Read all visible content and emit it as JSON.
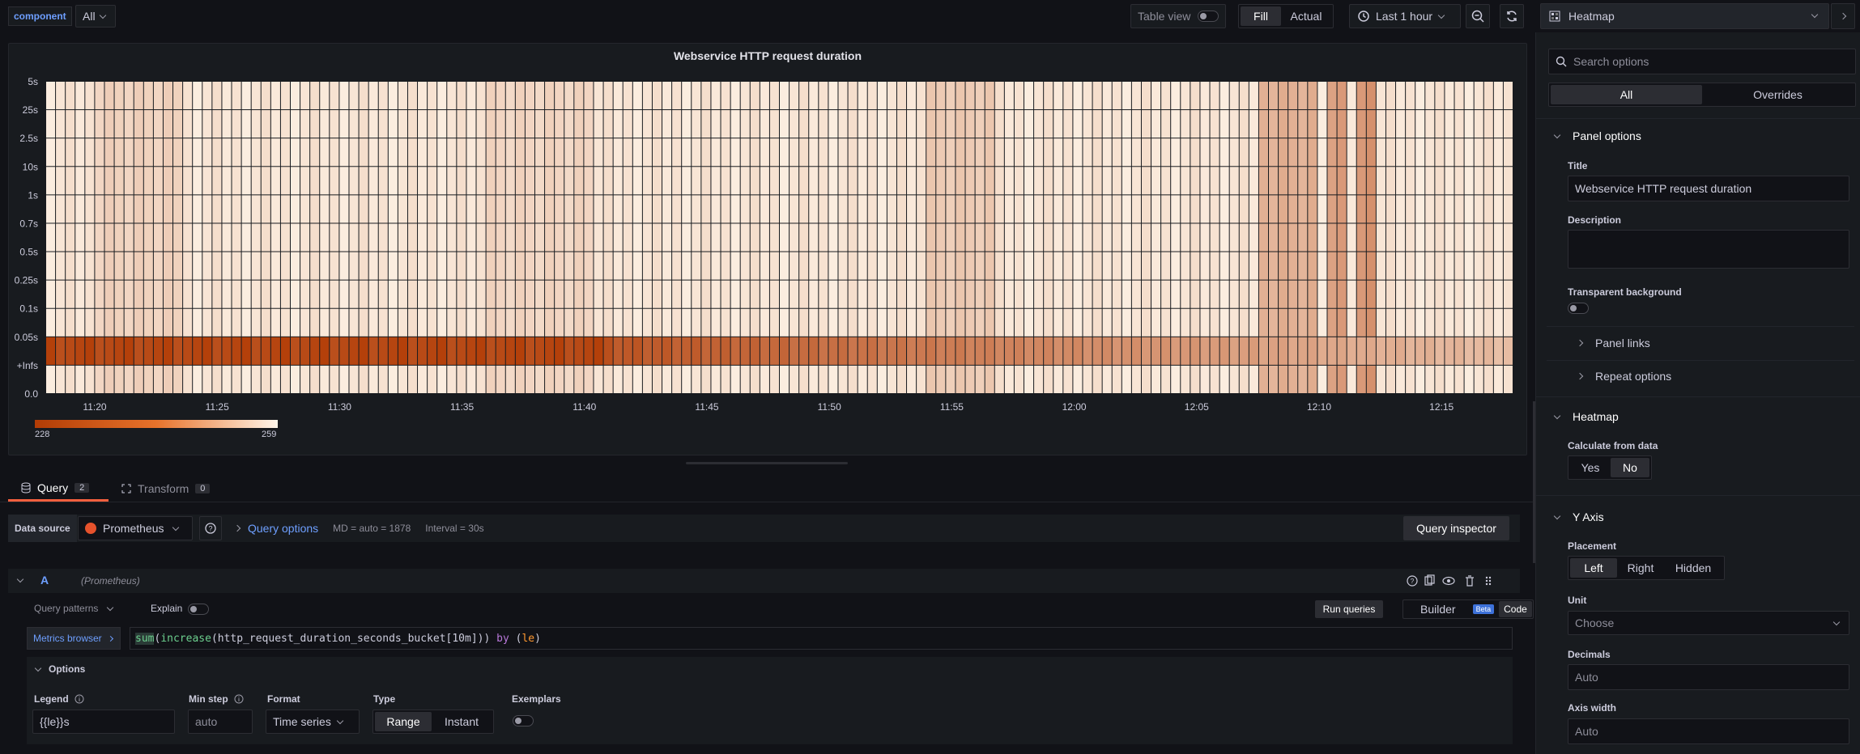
{
  "toolbar": {
    "var_label": "component",
    "var_value": "All",
    "table_view_label": "Table view",
    "fill_label": "Fill",
    "actual_label": "Actual",
    "time_range": "Last 1 hour",
    "viz_type": "Heatmap"
  },
  "panel": {
    "title": "Webservice HTTP request duration",
    "legend_min": "228",
    "legend_max": "259"
  },
  "chart_data": {
    "type": "heatmap",
    "title": "Webservice HTTP request duration",
    "y_buckets": [
      "5s",
      "25s",
      "2.5s",
      "10s",
      "1s",
      "0.7s",
      "0.5s",
      "0.25s",
      "0.1s",
      "0.05s",
      "+Infs",
      "0.0"
    ],
    "x_ticks": [
      "11:20",
      "11:25",
      "11:30",
      "11:35",
      "11:40",
      "11:45",
      "11:50",
      "11:55",
      "12:00",
      "12:05",
      "12:10",
      "12:15"
    ],
    "color_scale": {
      "min": 228,
      "max": 259,
      "low_color": "#b23c05",
      "high_color": "#fff6ea"
    },
    "legend_range": [
      228,
      259
    ]
  },
  "tabs": {
    "query_label": "Query",
    "query_count": "2",
    "transform_label": "Transform",
    "transform_count": "0"
  },
  "query_bar": {
    "datasource_label": "Data source",
    "datasource": "Prometheus",
    "query_options_label": "Query options",
    "md": "MD = auto = 1878",
    "interval": "Interval = 30s",
    "inspector_label": "Query inspector"
  },
  "query": {
    "ref_id": "A",
    "ds_name": "(Prometheus)",
    "patterns_label": "Query patterns",
    "explain_label": "Explain",
    "run_label": "Run queries",
    "builder_label": "Builder",
    "beta_label": "Beta",
    "code_label": "Code",
    "metrics_browser": "Metrics browser",
    "expr_parts": [
      "sum",
      "(",
      "increase",
      "(http_request_duration_seconds_bucket[10m])) ",
      "by",
      " (",
      "le",
      ")"
    ],
    "options_label": "Options",
    "legend_label": "Legend",
    "legend_value": "{{le}}s",
    "minstep_label": "Min step",
    "minstep_placeholder": "auto",
    "format_label": "Format",
    "format_value": "Time series",
    "type_label": "Type",
    "range_label": "Range",
    "instant_label": "Instant",
    "exemplars_label": "Exemplars"
  },
  "options_pane": {
    "search_placeholder": "Search options",
    "all_tab": "All",
    "overrides_tab": "Overrides",
    "panel_options": "Panel options",
    "title_label": "Title",
    "title_value": "Webservice HTTP request duration",
    "description_label": "Description",
    "transparent_label": "Transparent background",
    "panel_links": "Panel links",
    "repeat_options": "Repeat options",
    "heatmap_section": "Heatmap",
    "calc_label": "Calculate from data",
    "yes": "Yes",
    "no": "No",
    "yaxis_section": "Y Axis",
    "placement_label": "Placement",
    "left": "Left",
    "right": "Right",
    "hidden": "Hidden",
    "unit_label": "Unit",
    "unit_placeholder": "Choose",
    "decimals_label": "Decimals",
    "decimals_placeholder": "Auto",
    "axis_width_label": "Axis width",
    "axis_width_placeholder": "Auto"
  }
}
